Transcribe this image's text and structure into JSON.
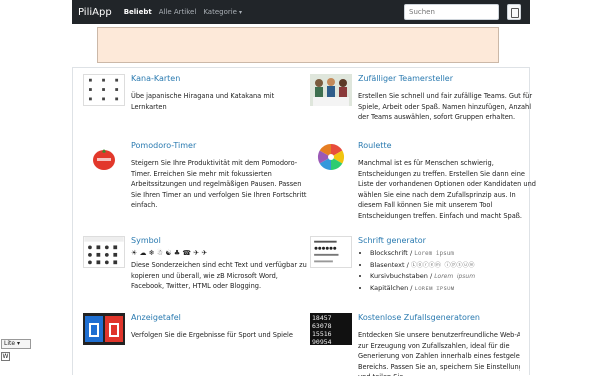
{
  "navbar": {
    "brand": "PiliApp",
    "links": [
      {
        "label": "Beliebt"
      },
      {
        "label": "Alle Artikel"
      },
      {
        "label": "Kategorie"
      }
    ],
    "search_placeholder": "Suchen"
  },
  "cards": [
    {
      "title": "Kana-Karten",
      "desc": "Übe japanische Hiragana und Katakana mit Lernkarten"
    },
    {
      "title": "Zufälliger Teamersteller",
      "desc": "Erstellen Sie schnell und fair zufällige Teams. Gut für Spiele, Arbeit oder Spaß. Namen hinzufügen, Anzahl der Teams auswählen, sofort Gruppen erhalten."
    },
    {
      "title": "Pomodoro-Timer",
      "desc": "Steigern Sie Ihre Produktivität mit dem Pomodoro-Timer. Erreichen Sie mehr mit fokussierten Arbeitssitzungen und regelmäßigen Pausen. Passen Sie Ihren Timer an und verfolgen Sie Ihren Fortschritt einfach."
    },
    {
      "title": "Roulette",
      "desc": "Manchmal ist es für Menschen schwierig, Entscheidungen zu treffen. Erstellen Sie dann eine Liste der vorhandenen Optionen oder Kandidaten und wählen Sie eine nach dem Zufallsprinzip aus. In diesem Fall können Sie mit unserem Tool Entscheidungen treffen. Einfach und macht Spaß."
    },
    {
      "title": "Symbol",
      "symbols": "☀ ☁ ❄ ☃ ☯ ♣ ☎ ✈ ✈",
      "desc": "Diese Sonderzeichen sind echt Text und verfügbar zu kopieren und überall, wie zB Microsoft Word, Facebook, Twitter, HTML oder Blogging."
    },
    {
      "title": "Schrift generator",
      "items": [
        {
          "label": "Blockschrift",
          "example": "Lorem ipsum"
        },
        {
          "label": "Blasentext",
          "example": "Ⓛⓞⓡⓔⓜ ⓘⓟⓢⓤⓜ"
        },
        {
          "label": "Kursivbuchstaben",
          "example": "𝘓𝘰𝘳𝘦𝘮 𝘪𝘱𝘴𝘶𝘮"
        },
        {
          "label": "Kapitälchen",
          "example": "ʟᴏʀᴇᴍ ɪᴘsᴜᴍ"
        }
      ]
    },
    {
      "title": "Anzeigetafel",
      "desc": "Verfolgen Sie die Ergebnisse für Sport und Spiele"
    },
    {
      "title": "Kostenlose Zufallsgeneratoren",
      "desc": "Entdecken Sie unsere benutzerfreundliche Web-App zur Erzeugung von Zufallszahlen, ideal für die Generierung von Zahlen innerhalb eines festgelegten Bereichs. Passen Sie an, speichern Sie Einstellungen und teilen Sie"
    }
  ],
  "language": {
    "selected": "Lite"
  },
  "colors": {
    "navbar": "#212529",
    "link": "#2a7ab0",
    "ad_bg": "#fde9d9"
  }
}
